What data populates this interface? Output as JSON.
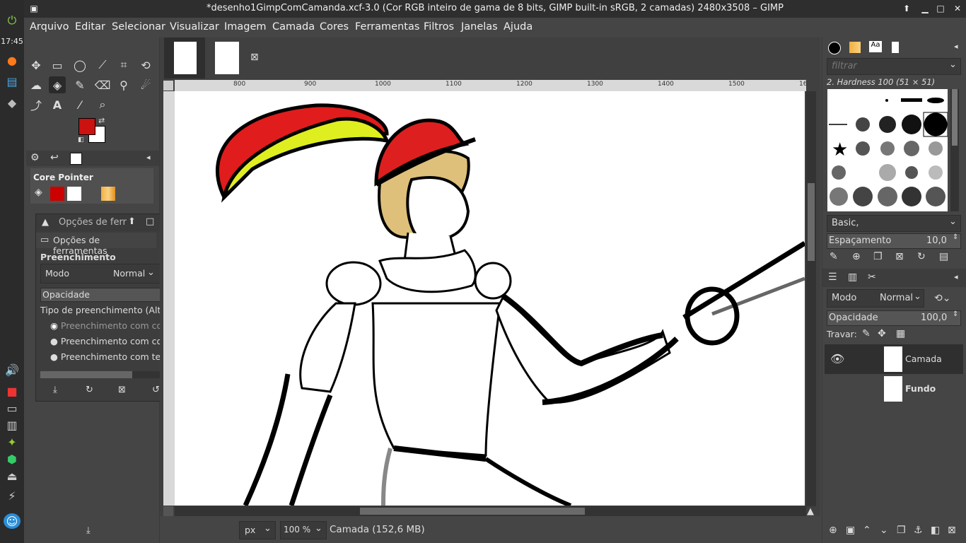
{
  "window": {
    "title": "*desenho1GimpComCamanda.xcf-3.0 (Cor RGB inteiro de gama de 8 bits, GIMP built-in sRGB, 2 camadas) 2480x3508 – GIMP"
  },
  "launcher": {
    "clock": "17:45"
  },
  "menu": [
    "Arquivo",
    "Editar",
    "Selecionar",
    "Visualizar",
    "Imagem",
    "Camada",
    "Cores",
    "Ferramentas",
    "Filtros",
    "Janelas",
    "Ajuda"
  ],
  "toolbox": {
    "device_section_title": "Core Pointer",
    "colors": {
      "foreground": "#cc1111",
      "background": "#ffffff"
    }
  },
  "tool_options": {
    "window_title": "Opções de ferr",
    "tab_label": "Opções de ferramentas",
    "section_title": "Preenchimento",
    "mode_label": "Modo",
    "mode_value": "Normal",
    "opacity_label": "Opacidade",
    "fill_type_label": "Tipo de preenchimento  (Alt)",
    "fill_options": [
      "Preenchimento com cor d",
      "Preenchimento com cor d",
      "Preenchimento com textu"
    ]
  },
  "rulers": {
    "h_ticks": [
      "800",
      "900",
      "1000",
      "1100",
      "1200",
      "1300",
      "1400",
      "1500",
      "16"
    ]
  },
  "status": {
    "unit": "px",
    "zoom": "100 %",
    "info": "Camada (152,6 MB)"
  },
  "brushes": {
    "filter_placeholder": "filtrar",
    "selected_brush": "2. Hardness 100 (51 × 51)",
    "preset": "Basic,",
    "spacing_label": "Espaçamento",
    "spacing_value": "10,0",
    "tab_text_icon": "Aa"
  },
  "layers": {
    "mode_label": "Modo",
    "mode_value": "Normal",
    "opacity_label": "Opacidade",
    "opacity_value": "100,0",
    "lock_label": "Travar:",
    "items": [
      {
        "name": "Camada",
        "visible": true,
        "selected": true
      },
      {
        "name": "Fundo",
        "visible": false,
        "selected": false
      }
    ]
  }
}
